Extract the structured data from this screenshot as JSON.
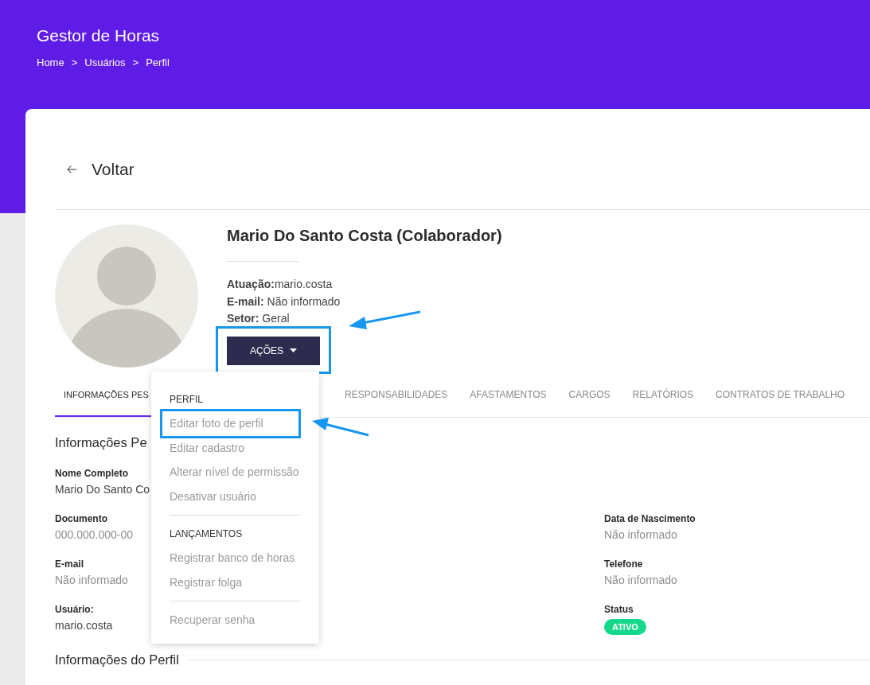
{
  "header": {
    "title": "Gestor de Horas",
    "breadcrumb": [
      "Home",
      "Usuários",
      "Perfil"
    ],
    "separator": ">"
  },
  "back": {
    "label": "Voltar"
  },
  "profile": {
    "name": "Mario Do Santo Costa (Colaborador)",
    "lines": [
      "**Atuação:**mario.costa",
      "**E-mail:** Não informado",
      "**Setor:** Geral"
    ],
    "actions_button": {
      "label": "AÇÕES",
      "highlighted": true
    }
  },
  "tabs": [
    {
      "label": "INFORMAÇÕES PES",
      "selected": true
    },
    {
      "label": "RESPONSABILIDADES",
      "selected": false
    },
    {
      "label": "AFASTAMENTOS",
      "selected": false
    },
    {
      "label": "CARGOS",
      "selected": false
    },
    {
      "label": "RELATÓRIOS",
      "selected": false
    },
    {
      "label": "CONTRATOS DE TRABALHO",
      "selected": false
    }
  ],
  "sections": [
    {
      "title": "Informações Pe",
      "rows": [
        {
          "left": {
            "label": "Nome Completo",
            "value": "Mario Do Santo Co",
            "kind": "text",
            "muted": false
          }
        },
        {
          "left": {
            "label": "Documento",
            "value": "000.000.000-00",
            "kind": "text",
            "muted": true
          },
          "right": {
            "label": "Data de Nascimento",
            "value": "Não informado",
            "kind": "text",
            "muted": true
          }
        },
        {
          "left": {
            "label": "E-mail",
            "value": "Não informado",
            "kind": "text",
            "muted": true
          },
          "right": {
            "label": "Telefone",
            "value": "Não informado",
            "kind": "text",
            "muted": true
          }
        },
        {
          "left": {
            "label": "Usuário:",
            "value": "mario.costa",
            "kind": "text",
            "muted": false
          },
          "right": {
            "label": "Status",
            "value": "ATIVO",
            "kind": "badge"
          }
        }
      ]
    },
    {
      "title": "Informações do Perfil"
    }
  ],
  "menu": {
    "sections": [
      {
        "title": "PERFIL",
        "items": [
          {
            "label": "Editar foto de perfil",
            "highlighted": true
          },
          {
            "label": "Editar cadastro",
            "highlighted": false
          },
          {
            "label": "Alterar nível de permissão",
            "highlighted": false
          },
          {
            "label": "Desativar usuário",
            "highlighted": false
          }
        ]
      },
      {
        "title": "LANÇAMENTOS",
        "items": [
          {
            "label": "Registrar banco de horas",
            "highlighted": false
          },
          {
            "label": "Registrar folga",
            "highlighted": false
          }
        ]
      },
      {
        "items": [
          {
            "label": "Recuperar senha",
            "highlighted": false
          }
        ]
      }
    ]
  }
}
